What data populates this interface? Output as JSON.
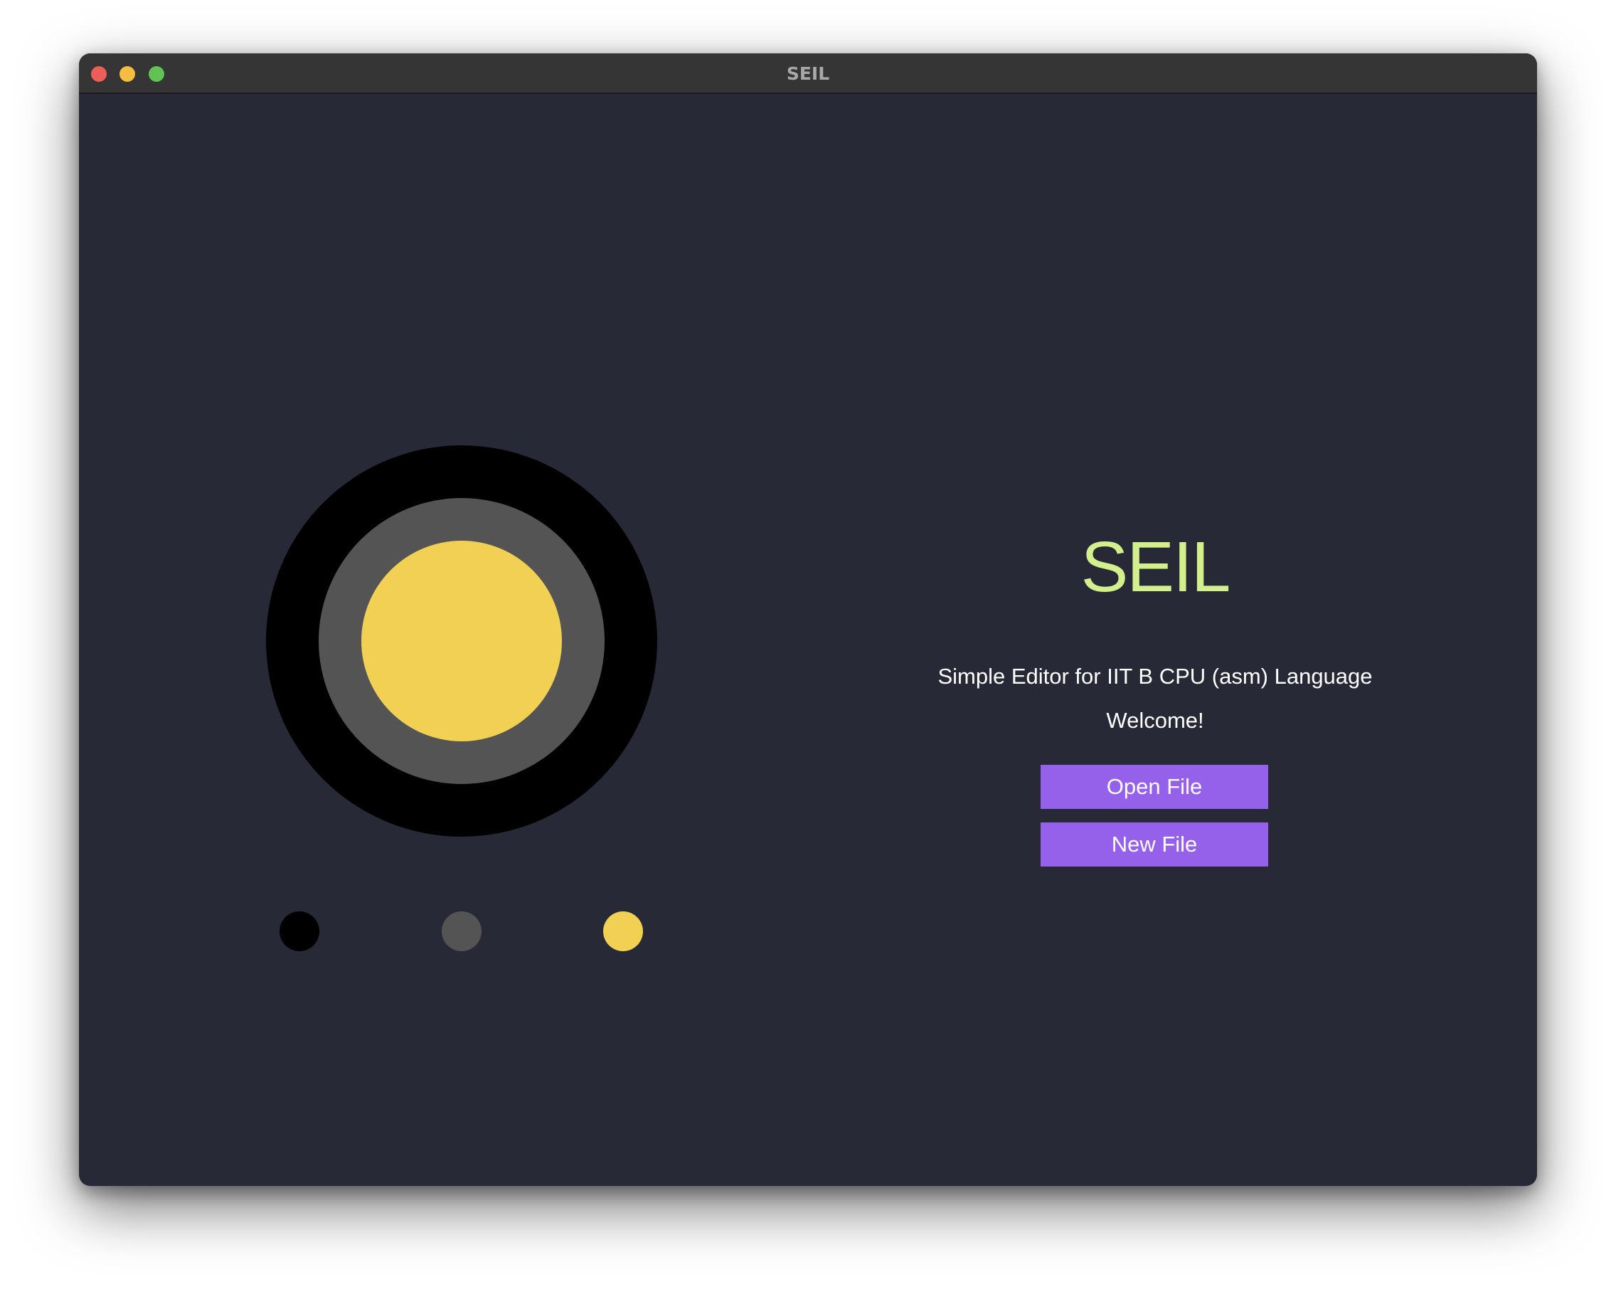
{
  "window": {
    "title": "SEIL"
  },
  "palette": {
    "colors": [
      "#000000",
      "#545454",
      "#f2d054"
    ]
  },
  "welcome_panel": {
    "app_title": "SEIL",
    "subtitle": "Simple Editor for IIT B CPU (asm) Language",
    "greeting": "Welcome!",
    "open_file_label": "Open File",
    "new_file_label": "New File"
  },
  "theme": {
    "background": "#272a36",
    "title_color": "#d4f08c",
    "button_color": "#9661ea",
    "text_color": "#ffffff"
  }
}
